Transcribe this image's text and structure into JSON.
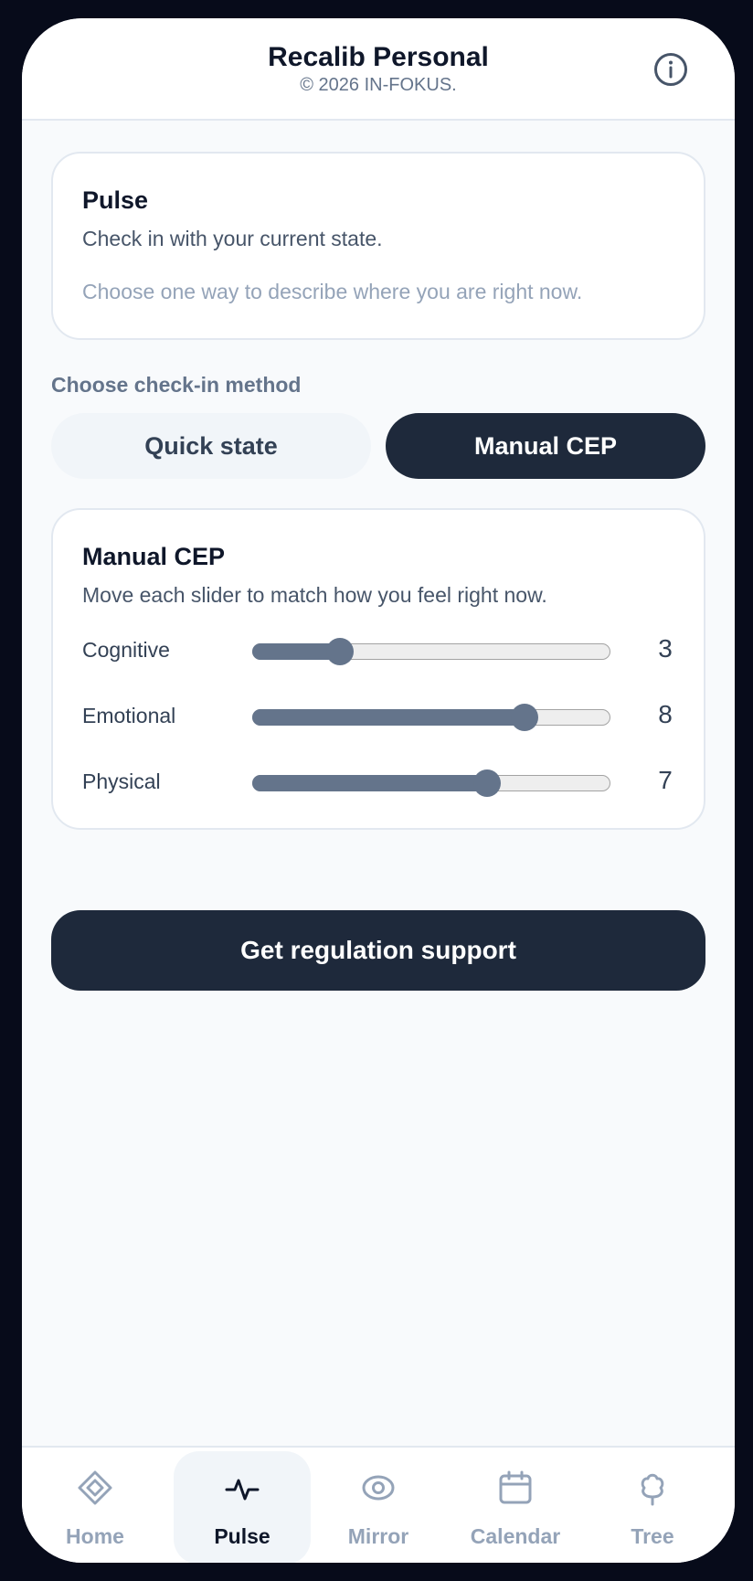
{
  "header": {
    "title": "Recalib Personal",
    "subtitle": "© 2026 IN-FOKUS.",
    "info_icon": "info-icon"
  },
  "intro_card": {
    "title": "Pulse",
    "text": "Check in with your current state.",
    "hint": "Choose one way to describe where you are right now."
  },
  "method": {
    "label": "Choose check-in method",
    "options": [
      "Quick state",
      "Manual CEP"
    ],
    "selected": "Manual CEP"
  },
  "manual_card": {
    "title": "Manual CEP",
    "text": "Move each slider to match how you feel right now.",
    "sliders": [
      {
        "label": "Cognitive",
        "value": "3",
        "min": 1,
        "max": 10
      },
      {
        "label": "Emotional",
        "value": "8",
        "min": 1,
        "max": 10
      },
      {
        "label": "Physical",
        "value": "7",
        "min": 1,
        "max": 10
      }
    ]
  },
  "action": {
    "label": "Get regulation support"
  },
  "nav": {
    "active": "Pulse",
    "items": [
      {
        "label": "Home",
        "icon": "diamond-icon"
      },
      {
        "label": "Pulse",
        "icon": "pulse-icon"
      },
      {
        "label": "Mirror",
        "icon": "eye-icon"
      },
      {
        "label": "Calendar",
        "icon": "calendar-icon"
      },
      {
        "label": "Tree",
        "icon": "tree-icon"
      }
    ]
  },
  "colors": {
    "primary": "#1e293b",
    "slider": "#64748b",
    "background": "#f8fafc",
    "muted": "#94a3b8"
  }
}
